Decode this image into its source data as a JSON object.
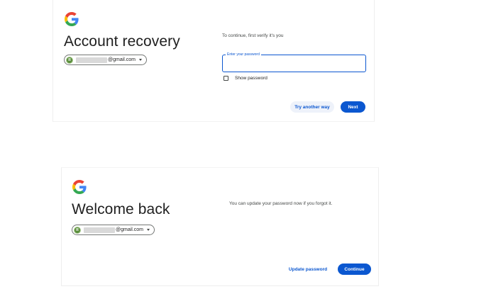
{
  "recovery": {
    "heading": "Account recovery",
    "account": {
      "avatar_letter": "R",
      "email_domain": "@gmail.com"
    },
    "instruction": "To continue, first verify it's you",
    "password_field": {
      "label": "Enter your password",
      "value": ""
    },
    "show_password_label": "Show password",
    "try_another_way_label": "Try another way",
    "next_label": "Next"
  },
  "welcome": {
    "heading": "Welcome back",
    "account": {
      "avatar_letter": "R",
      "email_domain": "@gmail.com"
    },
    "message": "You can update your password now if you forgot it.",
    "update_password_label": "Update password",
    "continue_label": "Continue"
  },
  "colors": {
    "primary": "#0b57d0",
    "google_blue": "#4285F4",
    "google_red": "#EA4335",
    "google_yellow": "#FBBC05",
    "google_green": "#34A853"
  }
}
